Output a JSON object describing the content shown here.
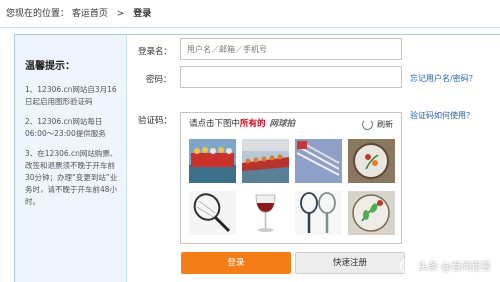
{
  "breadcrumb": {
    "prefix": "您现在的位置：",
    "home": "客运首页",
    "separator": ">",
    "current": "登录"
  },
  "tips": {
    "title": "温馨提示：",
    "items": [
      "1、12306.cn网站自3月16日起启用图形验证码",
      "2、12306.cn网站每日06:00～23:00提供服务",
      "3、在12306.cn网站购票、改签和退票须不晚于开车前30分钟；办理“变更到站”业务时，请不晚于开车前48小时。"
    ]
  },
  "form": {
    "username_label": "登录名：",
    "username_placeholder": "用户名／邮箱／手机号",
    "password_label": "密码：",
    "captcha_label": "验证码：",
    "forgot_link": "忘记用户名/密码？",
    "captcha_help_link": "验证码如何使用？"
  },
  "captcha": {
    "instruction_before": "请点击下图中",
    "instruction_highlight": "所有的",
    "target_word": "网球拍",
    "refresh_label": "刷新",
    "images": [
      "dragon-boat",
      "dragon-boat-race",
      "chopsticks",
      "embroidery",
      "tennis-racket",
      "wine-glass",
      "tennis-racket-pair",
      "embroidery-flower"
    ]
  },
  "buttons": {
    "login": "登录",
    "register": "快速注册"
  },
  "watermark": "头条 @百问百答",
  "colors": {
    "accent_orange": "#f57d18",
    "link_blue": "#1f5fa8",
    "highlight_red": "#d0021b",
    "panel_bg": "#eef5fc"
  }
}
